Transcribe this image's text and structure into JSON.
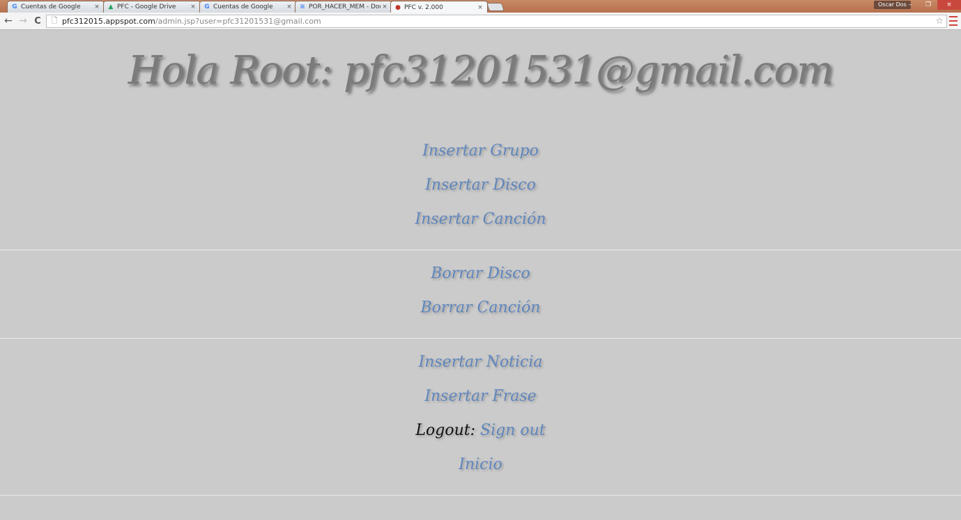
{
  "browser": {
    "tabs": [
      {
        "title": "Cuentas de Google",
        "icon": "google-g-icon",
        "icon_glyph": "G",
        "icon_color": "#4285f4"
      },
      {
        "title": "PFC - Google Drive",
        "icon": "google-drive-icon",
        "icon_glyph": "▲",
        "icon_color": "#1fa463"
      },
      {
        "title": "Cuentas de Google",
        "icon": "google-g-icon",
        "icon_glyph": "G",
        "icon_color": "#4285f4"
      },
      {
        "title": "POR_HACER_MEM - Docu",
        "icon": "google-docs-icon",
        "icon_glyph": "≡",
        "icon_color": "#4285f4"
      },
      {
        "title": "PFC v. 2.000",
        "icon": "pfc-favicon-icon",
        "icon_glyph": "●",
        "icon_color": "#c0392b",
        "active": true
      }
    ],
    "tab_close_glyph": "×",
    "profile_name": "Oscar Dos",
    "window_controls": {
      "minimize": "–",
      "restore": "❐",
      "close": "×"
    },
    "address": {
      "host": "pfc312015.appspot.com",
      "path": "/admin.jsp?user=pfc31201531@gmail.com"
    },
    "nav_glyphs": {
      "back": "←",
      "forward": "→",
      "reload": "C",
      "page": "🗋",
      "star": "☆"
    }
  },
  "page": {
    "heading": "Hola Root: pfc31201531@gmail.com",
    "sections": [
      {
        "links": [
          "Insertar Grupo",
          "Insertar Disco",
          "Insertar Canción"
        ]
      },
      {
        "links": [
          "Borrar Disco",
          "Borrar Canción"
        ]
      },
      {
        "links": [
          "Insertar Noticia",
          "Insertar Frase"
        ]
      }
    ],
    "logout_label": "Logout:",
    "logout_link": "Sign out",
    "home_link": "Inicio"
  },
  "colors": {
    "background": "#cbcbcb",
    "link": "#5f86bd",
    "heading": "#7b7b7b",
    "tabstrip": "#b6704d"
  }
}
